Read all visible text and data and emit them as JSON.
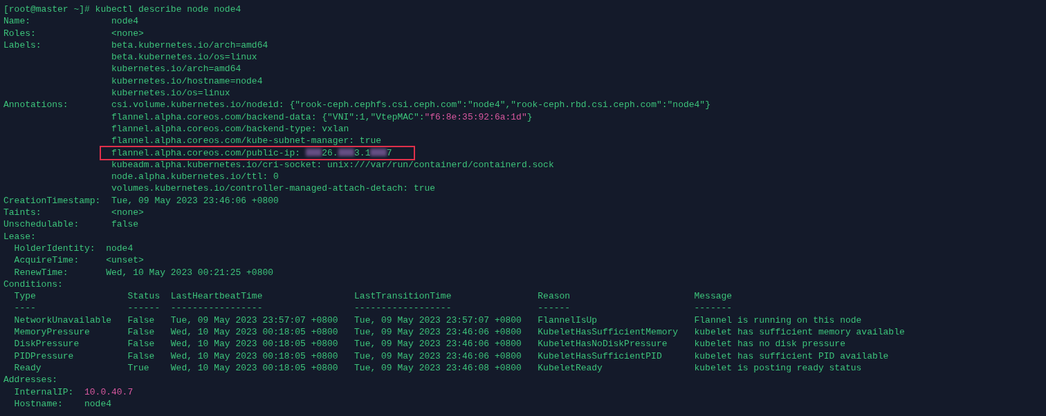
{
  "prompt": "[root@master ~]# kubectl describe node node4",
  "blocks": [
    {
      "kind": "field",
      "key": "Name:",
      "lines": [
        {
          "segments": [
            {
              "kind": "text",
              "text": "node4",
              "accent": false
            }
          ],
          "highlighted": false
        }
      ]
    },
    {
      "kind": "field",
      "key": "Roles:",
      "lines": [
        {
          "segments": [
            {
              "kind": "text",
              "text": "<none>",
              "accent": false
            }
          ],
          "highlighted": false
        }
      ]
    },
    {
      "kind": "field",
      "key": "Labels:",
      "lines": [
        {
          "segments": [
            {
              "kind": "text",
              "text": "beta.kubernetes.io/arch=amd64",
              "accent": false
            }
          ],
          "highlighted": false
        },
        {
          "segments": [
            {
              "kind": "text",
              "text": "beta.kubernetes.io/os=linux",
              "accent": false
            }
          ],
          "highlighted": false
        },
        {
          "segments": [
            {
              "kind": "text",
              "text": "kubernetes.io/arch=amd64",
              "accent": false
            }
          ],
          "highlighted": false
        },
        {
          "segments": [
            {
              "kind": "text",
              "text": "kubernetes.io/hostname=node4",
              "accent": false
            }
          ],
          "highlighted": false
        },
        {
          "segments": [
            {
              "kind": "text",
              "text": "kubernetes.io/os=linux",
              "accent": false
            }
          ],
          "highlighted": false
        }
      ]
    },
    {
      "kind": "field",
      "key": "Annotations:",
      "lines": [
        {
          "segments": [
            {
              "kind": "text",
              "text": "csi.volume.kubernetes.io/nodeid: {\"rook-ceph.cephfs.csi.ceph.com\":\"node4\",\"rook-ceph.rbd.csi.ceph.com\":\"node4\"}",
              "accent": false
            }
          ],
          "highlighted": false
        },
        {
          "segments": [
            {
              "kind": "text",
              "text": "flannel.alpha.coreos.com/backend-data: {\"VNI\":1,\"VtepMAC\":",
              "accent": false
            },
            {
              "kind": "text",
              "text": "\"f6:8e:35:92:6a:1d\"",
              "accent": true
            },
            {
              "kind": "text",
              "text": "}",
              "accent": false
            }
          ],
          "highlighted": false
        },
        {
          "segments": [
            {
              "kind": "text",
              "text": "flannel.alpha.coreos.com/backend-type: vxlan",
              "accent": false
            }
          ],
          "highlighted": false
        },
        {
          "segments": [
            {
              "kind": "text",
              "text": "flannel.alpha.coreos.com/kube-subnet-manager: true",
              "accent": false
            }
          ],
          "highlighted": false
        },
        {
          "segments": [
            {
              "kind": "text",
              "text": "flannel.alpha.coreos.com/public-ip: ",
              "accent": false
            },
            {
              "kind": "redacted"
            },
            {
              "kind": "text",
              "text": "26.",
              "accent": false
            },
            {
              "kind": "redacted"
            },
            {
              "kind": "text",
              "text": "3.1",
              "accent": false
            },
            {
              "kind": "redacted"
            },
            {
              "kind": "text",
              "text": "7",
              "accent": false
            }
          ],
          "highlighted": true
        },
        {
          "segments": [
            {
              "kind": "text",
              "text": "kubeadm.alpha.kubernetes.io/cri-socket: unix:///var/run/containerd/containerd.sock",
              "accent": false
            }
          ],
          "highlighted": false
        },
        {
          "segments": [
            {
              "kind": "text",
              "text": "node.alpha.kubernetes.io/ttl: 0",
              "accent": false
            }
          ],
          "highlighted": false
        },
        {
          "segments": [
            {
              "kind": "text",
              "text": "volumes.kubernetes.io/controller-managed-attach-detach: true",
              "accent": false
            }
          ],
          "highlighted": false
        }
      ]
    },
    {
      "kind": "field",
      "key": "CreationTimestamp:",
      "lines": [
        {
          "segments": [
            {
              "kind": "text",
              "text": "Tue, 09 May 2023 23:46:06 +0800",
              "accent": false
            }
          ],
          "highlighted": false
        }
      ]
    },
    {
      "kind": "field",
      "key": "Taints:",
      "lines": [
        {
          "segments": [
            {
              "kind": "text",
              "text": "<none>",
              "accent": false
            }
          ],
          "highlighted": false
        }
      ]
    },
    {
      "kind": "field",
      "key": "Unschedulable:",
      "lines": [
        {
          "segments": [
            {
              "kind": "text",
              "text": "false",
              "accent": false
            }
          ],
          "highlighted": false
        }
      ]
    },
    {
      "kind": "group",
      "title": "Lease:",
      "items": [
        {
          "key": "HolderIdentity:",
          "value": "node4",
          "accent": false
        },
        {
          "key": "AcquireTime:",
          "value": "<unset>",
          "accent": false
        },
        {
          "key": "RenewTime:",
          "value": "Wed, 10 May 2023 00:21:25 +0800",
          "accent": false
        }
      ]
    },
    {
      "kind": "table",
      "title": "Conditions:",
      "columns": [
        "Type",
        "Status",
        "LastHeartbeatTime",
        "LastTransitionTime",
        "Reason",
        "Message"
      ],
      "underlines": [
        "----",
        "------",
        "-----------------",
        "------------------",
        "------",
        "-------"
      ],
      "rows": [
        [
          "NetworkUnavailable",
          "False",
          "Tue, 09 May 2023 23:57:07 +0800",
          "Tue, 09 May 2023 23:57:07 +0800",
          "FlannelIsUp",
          "Flannel is running on this node"
        ],
        [
          "MemoryPressure",
          "False",
          "Wed, 10 May 2023 00:18:05 +0800",
          "Tue, 09 May 2023 23:46:06 +0800",
          "KubeletHasSufficientMemory",
          "kubelet has sufficient memory available"
        ],
        [
          "DiskPressure",
          "False",
          "Wed, 10 May 2023 00:18:05 +0800",
          "Tue, 09 May 2023 23:46:06 +0800",
          "KubeletHasNoDiskPressure",
          "kubelet has no disk pressure"
        ],
        [
          "PIDPressure",
          "False",
          "Wed, 10 May 2023 00:18:05 +0800",
          "Tue, 09 May 2023 23:46:06 +0800",
          "KubeletHasSufficientPID",
          "kubelet has sufficient PID available"
        ],
        [
          "Ready",
          "True",
          "Wed, 10 May 2023 00:18:05 +0800",
          "Tue, 09 May 2023 23:46:08 +0800",
          "KubeletReady",
          "kubelet is posting ready status"
        ]
      ]
    },
    {
      "kind": "group",
      "title": "Addresses:",
      "items": [
        {
          "key": "InternalIP:",
          "value": "10.0.40.7",
          "accent": true
        },
        {
          "key": "Hostname:",
          "value": "node4",
          "accent": false
        }
      ]
    }
  ]
}
